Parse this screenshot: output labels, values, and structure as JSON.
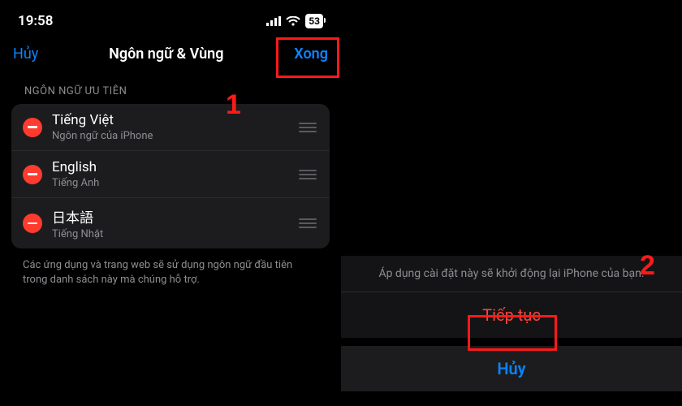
{
  "status": {
    "time": "19:58",
    "battery": "53"
  },
  "nav": {
    "cancel": "Hủy",
    "title": "Ngôn ngữ & Vùng",
    "done": "Xong"
  },
  "section": {
    "header": "NGÔN NGỮ ƯU TIÊN"
  },
  "languages": [
    {
      "title": "Tiếng Việt",
      "subtitle": "Ngôn ngữ của iPhone"
    },
    {
      "title": "English",
      "subtitle": "Tiếng Anh"
    },
    {
      "title": "日本語",
      "subtitle": "Tiếng Nhật"
    }
  ],
  "footer": "Các ứng dụng và trang web sẽ sử dụng ngôn ngữ đầu tiên trong danh sách này mà chúng hỗ trợ.",
  "sheet": {
    "message": "Áp dụng cài đặt này sẽ khởi động lại iPhone của bạn.",
    "continue": "Tiếp tục",
    "cancel": "Hủy"
  },
  "annotations": {
    "step1": "1",
    "step2": "2"
  }
}
